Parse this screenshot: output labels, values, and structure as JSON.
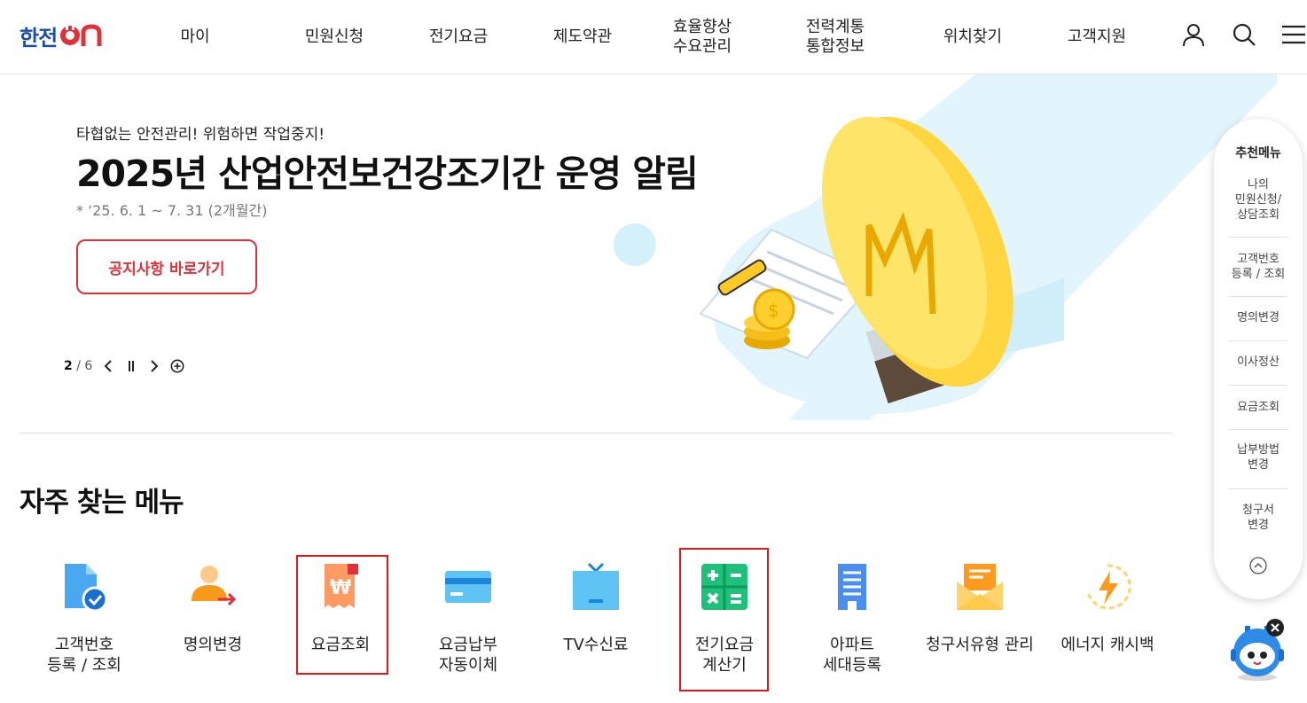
{
  "header": {
    "logo_text": "한전",
    "logo_on": "ON",
    "nav": [
      {
        "label": "마이"
      },
      {
        "label": "민원신청"
      },
      {
        "label": "전기요금"
      },
      {
        "label": "제도약관"
      },
      {
        "label": "효율향상\n수요관리"
      },
      {
        "label": "전력계통\n통합정보"
      },
      {
        "label": "위치찾기"
      },
      {
        "label": "고객지원"
      }
    ],
    "icons": [
      "user-icon",
      "search-icon",
      "menu-icon"
    ]
  },
  "hero": {
    "subtitle": "타협없는 안전관리! 위험하면 작업중지!",
    "title": "2025년 산업안전보건강조기간 운영 알림",
    "date": "* ‘25. 6. 1 ~ 7. 31 (2개월간)",
    "button": "공지사항 바로가기",
    "pager": {
      "current": "2",
      "separator": "/",
      "total": "6"
    },
    "colors": {
      "accent": "#e0303a",
      "bg_band": "#e3f5fc",
      "bulb": "#ffd43b"
    }
  },
  "frequent": {
    "title": "자주 찾는 메뉴",
    "items": [
      {
        "label": "고객번호\n등록 / 조회",
        "icon": "document-check-icon"
      },
      {
        "label": "명의변경",
        "icon": "person-swap-icon"
      },
      {
        "label": "요금조회",
        "icon": "won-receipt-icon",
        "highlighted": true
      },
      {
        "label": "요금납부\n자동이체",
        "icon": "credit-card-icon"
      },
      {
        "label": "TV수신료",
        "icon": "tv-icon"
      },
      {
        "label": "전기요금\n계산기",
        "icon": "calculator-icon",
        "highlighted": true
      },
      {
        "label": "아파트\n세대등록",
        "icon": "apartment-icon"
      },
      {
        "label": "청구서유형 관리",
        "icon": "envelope-icon"
      },
      {
        "label": "에너지 캐시백",
        "icon": "energy-bolt-icon"
      }
    ]
  },
  "rail": {
    "title": "추천메뉴",
    "items": [
      {
        "label": "나의\n민원신청/\n상담조회"
      },
      {
        "label": "고객번호\n등록 / 조회"
      },
      {
        "label": "명의변경"
      },
      {
        "label": "이사정산"
      },
      {
        "label": "요금조회"
      },
      {
        "label": "납부방법\n변경"
      },
      {
        "label": "청구서\n변경"
      }
    ]
  }
}
